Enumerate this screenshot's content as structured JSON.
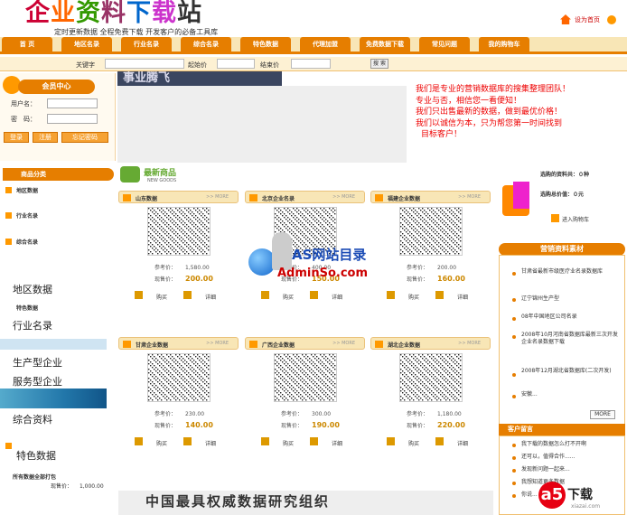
{
  "header": {
    "logo_text": [
      "企",
      "业",
      "资",
      "料",
      "下",
      "载",
      "站"
    ],
    "slogan": "定时更新数据 全程免费下载 开发客户的必备工具库",
    "home_link": "设为首页"
  },
  "nav": [
    "首 页",
    "地区名录",
    "行业名录",
    "综合名录",
    "特色数据",
    "代理加盟",
    "免费数据下载",
    "常见问题",
    "我的购物车"
  ],
  "search": {
    "keyword_label": "关键字",
    "start_price_label": "起始价",
    "end_price_label": "结束价",
    "button": "搜 索"
  },
  "member": {
    "title": "会员中心",
    "username_label": "用户名：",
    "password_label": "密　码：",
    "buttons": [
      "登录",
      "注册",
      "忘记密码"
    ]
  },
  "banner": {
    "left_text": "事业腾飞",
    "lines": [
      "我们是专业的营销数据库的搜集整理团队！",
      "专业与否，相信您一看便知！",
      "我们只出售最新的数据，做到最优价格！",
      "我们以诚信为本，只为帮您第一时间找到",
      "目标客户！"
    ]
  },
  "categories": {
    "title": "商品分类",
    "items": [
      "地区数据",
      "行业名录",
      "综合名录"
    ],
    "overlay": [
      "地区数据",
      "行业名录",
      "生产型企业",
      "服务型企业",
      "综合资料",
      "特色数据"
    ],
    "hidden_item": "特色数据",
    "bottom_item": "所有数据全部打包",
    "bottom_price_label": "现售价：",
    "bottom_price": "1,000.00"
  },
  "new_products": {
    "title": "最新商品",
    "subtitle": "NEW GOODS"
  },
  "products": [
    {
      "name": "山东数据",
      "more": ">> MORE",
      "ref_label": "参考价：",
      "ref": "1,580.00",
      "price_label": "现售价：",
      "price": "200.00",
      "buy": "购买",
      "detail": "详细"
    },
    {
      "name": "北京企业名录",
      "more": ">> MORE",
      "ref_label": "参考价：",
      "ref": "400.00",
      "price_label": "现售价：",
      "price": "150.00",
      "buy": "购买",
      "detail": "详细"
    },
    {
      "name": "福建企业数据",
      "more": ">> MORE",
      "ref_label": "参考价：",
      "ref": "200.00",
      "price_label": "现售价：",
      "price": "160.00",
      "buy": "购买",
      "detail": "详细"
    },
    {
      "name": "甘肃企业数据",
      "more": ">> MORE",
      "ref_label": "参考价：",
      "ref": "230.00",
      "price_label": "现售价：",
      "price": "140.00",
      "buy": "购买",
      "detail": "详细"
    },
    {
      "name": "广西企业数据",
      "more": ">> MORE",
      "ref_label": "参考价：",
      "ref": "300.00",
      "price_label": "现售价：",
      "price": "190.00",
      "buy": "购买",
      "detail": "详细"
    },
    {
      "name": "湖北企业数据",
      "more": ">> MORE",
      "ref_label": "参考价：",
      "ref": "1,180.00",
      "price_label": "现售价：",
      "price": "220.00",
      "buy": "购买",
      "detail": "详细"
    }
  ],
  "watermark": {
    "t1": "AS网站目录",
    "t2": "AdminSo.com"
  },
  "bottom_banner": "中国最具权威数据研究组织",
  "cart": {
    "count_line": "选购的资料共：０种",
    "total_line": "选购总价值：０元",
    "enter": "进入购物车"
  },
  "sales": {
    "title": "营销资料素材",
    "items": [
      "甘肃省最新市级医疗业名录数据库",
      "辽宁锦州生产型",
      "08年中国地区公司名录",
      "2008年10月河南省数据库最新三次开发企业名录数据下载",
      "2008年12月湖北省数据库(二次开发)",
      "安徽..."
    ],
    "more": "MORE"
  },
  "customer": {
    "title": "客户留言",
    "items": [
      "我下载的数据怎么打不开啊",
      "还可以，值得合作......",
      "发现新问题一起来...",
      "我想知道更多数据",
      "你说...",
      ""
    ]
  },
  "xiazai": {
    "circle": "a5",
    "t": "下载",
    "s": "xiazai.com"
  }
}
